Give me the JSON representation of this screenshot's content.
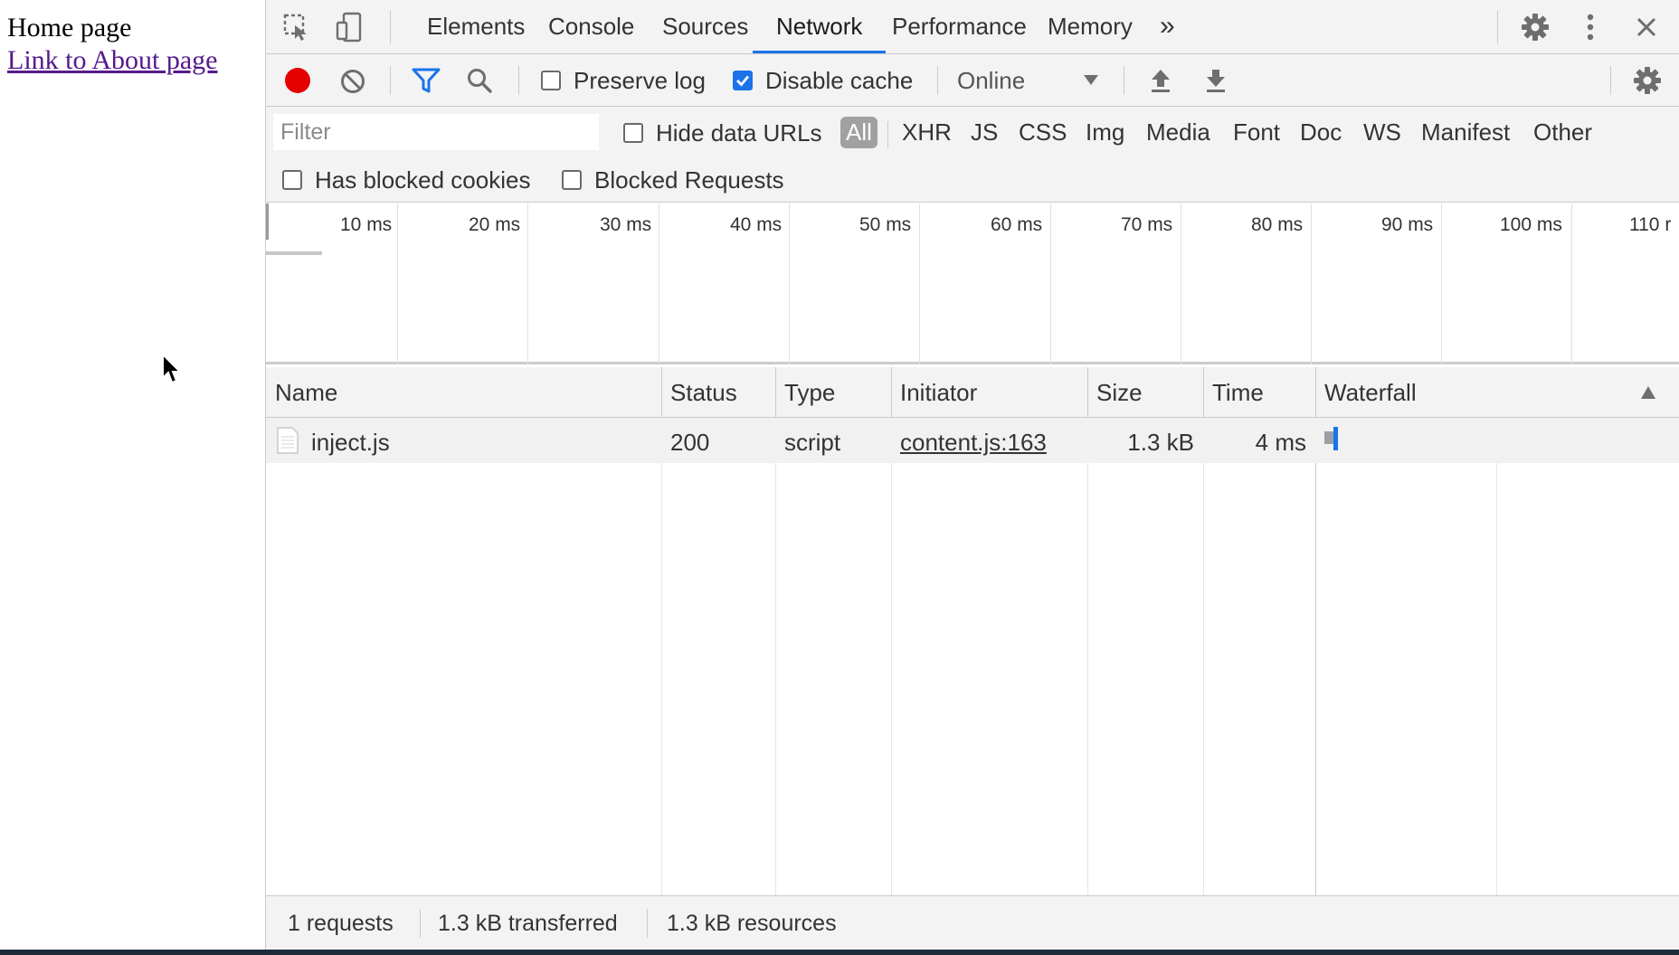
{
  "page": {
    "title": "Home page",
    "link": "Link to About page"
  },
  "devtools": {
    "tabs": [
      {
        "label": "Elements"
      },
      {
        "label": "Console"
      },
      {
        "label": "Sources"
      },
      {
        "label": "Network"
      },
      {
        "label": "Performance"
      },
      {
        "label": "Memory"
      }
    ],
    "active_tab": "Network",
    "more_tabs_label": "»",
    "toolbar": {
      "preserve_log_label": "Preserve log",
      "preserve_log_checked": false,
      "disable_cache_label": "Disable cache",
      "disable_cache_checked": true,
      "throttling_value": "Online"
    },
    "filter": {
      "placeholder": "Filter",
      "hide_data_urls_label": "Hide data URLs",
      "types": [
        "All",
        "XHR",
        "JS",
        "CSS",
        "Img",
        "Media",
        "Font",
        "Doc",
        "WS",
        "Manifest",
        "Other"
      ],
      "selected_type": "All",
      "has_blocked_cookies_label": "Has blocked cookies",
      "blocked_requests_label": "Blocked Requests"
    },
    "overview_ticks": [
      "10 ms",
      "20 ms",
      "30 ms",
      "40 ms",
      "50 ms",
      "60 ms",
      "70 ms",
      "80 ms",
      "90 ms",
      "100 ms",
      "110 r"
    ],
    "table": {
      "columns": {
        "name": "Name",
        "status": "Status",
        "type": "Type",
        "initiator": "Initiator",
        "size": "Size",
        "time": "Time",
        "waterfall": "Waterfall"
      },
      "rows": [
        {
          "name": "inject.js",
          "status": "200",
          "type": "script",
          "initiator": "content.js:163",
          "size": "1.3 kB",
          "time": "4 ms"
        }
      ]
    },
    "summary": {
      "requests": "1 requests",
      "transferred": "1.3 kB transferred",
      "resources": "1.3 kB resources"
    },
    "colors": {
      "accent": "#1a73e8",
      "record": "#e50000",
      "waterfall_bar": "#1a73e8"
    }
  }
}
